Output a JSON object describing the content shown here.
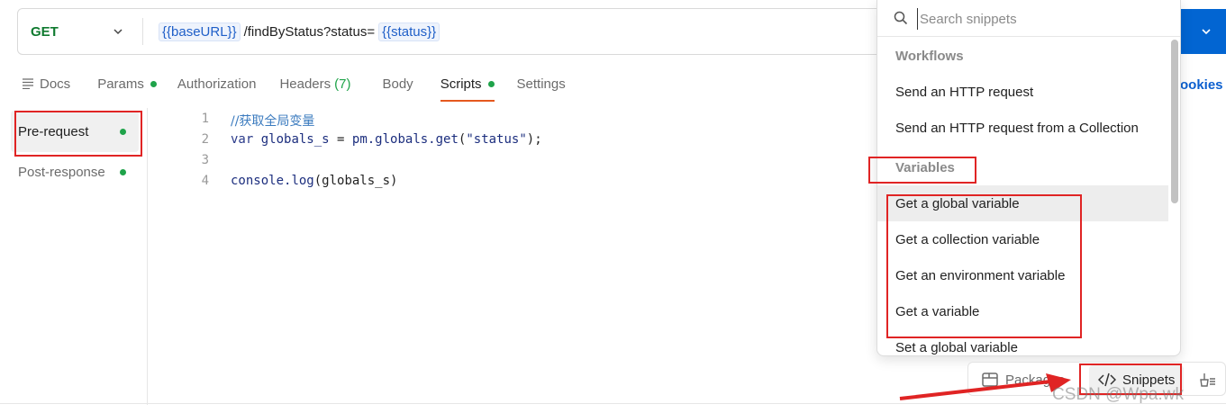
{
  "request": {
    "method": "GET",
    "url_var_base": "{{baseURL}}",
    "url_path": "/findByStatus?status=",
    "url_var_status": "{{status}}"
  },
  "tabs": [
    {
      "label": "Docs"
    },
    {
      "label": "Params"
    },
    {
      "label": "Authorization"
    },
    {
      "label": "Headers"
    },
    {
      "label": "Body"
    },
    {
      "label": "Scripts"
    },
    {
      "label": "Settings"
    }
  ],
  "headers_count": "(7)",
  "cookies_label": "ookies",
  "scripts_sidebar": {
    "pre_request": "Pre-request",
    "post_response": "Post-response"
  },
  "editor": {
    "line_numbers": [
      "1",
      "2",
      "3",
      "4"
    ],
    "line1": "//获取全局变量",
    "line2": {
      "kw": "var",
      "ident": "globals_s",
      "eq": " = ",
      "obj": "pm.globals.",
      "fn": "get",
      "open": "(",
      "str": "\"status\"",
      "close": ");"
    },
    "line4": {
      "obj": "console.",
      "fn": "log",
      "args": "(globals_s)"
    }
  },
  "snippets": {
    "search_placeholder": "Search snippets",
    "groups": [
      {
        "title": "Workflows",
        "items": [
          "Send an HTTP request",
          "Send an HTTP request from a Collection"
        ]
      },
      {
        "title": "Variables",
        "items": [
          "Get a global variable",
          "Get a collection variable",
          "Get an environment variable",
          "Get a variable",
          "Set a global variable"
        ]
      }
    ]
  },
  "bottom_bar": {
    "packages": "Packages",
    "snippets": "Snippets"
  },
  "watermark": "CSDN @Wpa.wk",
  "colors": {
    "accent_send": "#0265d2",
    "status_dot": "#1fa34a",
    "active_tab_underline": "#e5581e",
    "annotation": "#e02424"
  }
}
